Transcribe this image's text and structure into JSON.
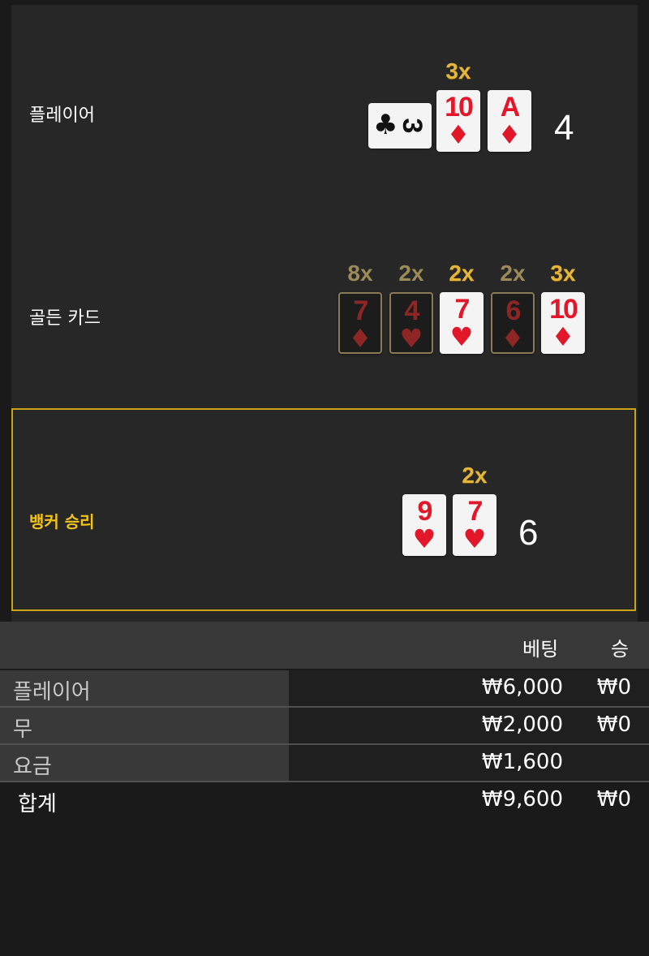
{
  "sections": {
    "player": {
      "label": "플레이어",
      "cards": [
        {
          "rank": "3",
          "suit": "♣",
          "sideways": true
        },
        {
          "rank": "10",
          "suit": "♦",
          "multiplier": "3x"
        },
        {
          "rank": "A",
          "suit": "♦"
        }
      ],
      "score": "4"
    },
    "golden": {
      "label": "골든 카드",
      "cards": [
        {
          "rank": "7",
          "suit": "♦",
          "multiplier": "8x",
          "dim": true
        },
        {
          "rank": "4",
          "suit": "♥",
          "multiplier": "2x",
          "dim": true
        },
        {
          "rank": "7",
          "suit": "♥",
          "multiplier": "2x"
        },
        {
          "rank": "6",
          "suit": "♦",
          "multiplier": "2x",
          "dim": true
        },
        {
          "rank": "10",
          "suit": "♦",
          "multiplier": "3x"
        }
      ]
    },
    "banker": {
      "label": "뱅커 승리",
      "cards": [
        {
          "rank": "9",
          "suit": "♥"
        },
        {
          "rank": "7",
          "suit": "♥",
          "multiplier": "2x"
        }
      ],
      "score": "6"
    }
  },
  "table": {
    "headers": {
      "bet": "베팅",
      "win": "승"
    },
    "rows": [
      {
        "label": "플레이어",
        "bet": "₩6,000",
        "win": "₩0"
      },
      {
        "label": "무",
        "bet": "₩2,000",
        "win": "₩0"
      },
      {
        "label": "요금",
        "bet": "₩1,600",
        "win": ""
      }
    ],
    "total": {
      "label": "합계",
      "bet": "₩9,600",
      "win": "₩0"
    }
  },
  "colors": {
    "highlight": "#f2c318",
    "card_red": "#e2182a",
    "gold": "#e4b73a"
  }
}
